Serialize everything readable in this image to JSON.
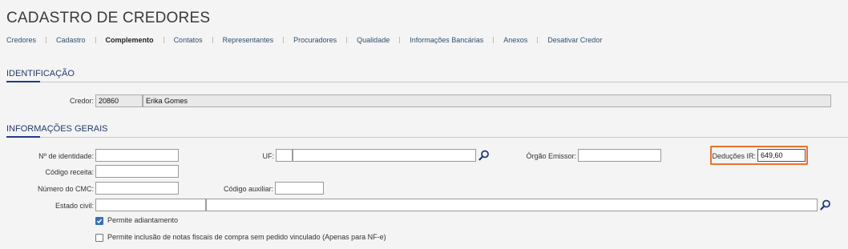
{
  "page": {
    "title": "CADASTRO DE CREDORES"
  },
  "nav": {
    "items": [
      {
        "label": "Credores"
      },
      {
        "label": "Cadastro"
      },
      {
        "label": "Complemento"
      },
      {
        "label": "Contatos"
      },
      {
        "label": "Representantes"
      },
      {
        "label": "Procuradores"
      },
      {
        "label": "Qualidade"
      },
      {
        "label": "Informações Bancárias"
      },
      {
        "label": "Anexos"
      },
      {
        "label": "Desativar Credor"
      }
    ],
    "active_index": 2
  },
  "identificacao": {
    "title": "IDENTIFICAÇÃO",
    "credor_label": "Credor:",
    "credor_code": "20860",
    "credor_name": "Erika Gomes"
  },
  "info_gerais": {
    "title": "INFORMAÇÕES GERAIS",
    "identidade_label": "Nº de identidade:",
    "identidade_value": "",
    "uf_label": "UF:",
    "uf_code": "",
    "uf_name": "",
    "orgao_label": "Órgão Emissor:",
    "orgao_value": "",
    "deducoes_label": "Deduções IR:",
    "deducoes_value": "649,60",
    "codigo_receita_label": "Código receita:",
    "codigo_receita_value": "",
    "cmc_label": "Número do CMC:",
    "cmc_value": "",
    "codigo_aux_label": "Código auxiliar:",
    "codigo_aux_value": "",
    "estado_civil_label": "Estado civil:",
    "estado_civil_code": "",
    "estado_civil_name": "",
    "permite_adiantamento_label": "Permite adiantamento",
    "permite_adiantamento_checked": true,
    "permite_nf_label": "Permite inclusão de notas fiscais de compra sem pedido vinculado (Apenas para NF-e)",
    "permite_nf_checked": false
  },
  "icons": {
    "lookup": "magnifier-icon",
    "check": "checkmark-icon"
  },
  "colors": {
    "accent": "#223a8a",
    "highlight": "#e8742d",
    "checkbox": "#3571b8"
  }
}
